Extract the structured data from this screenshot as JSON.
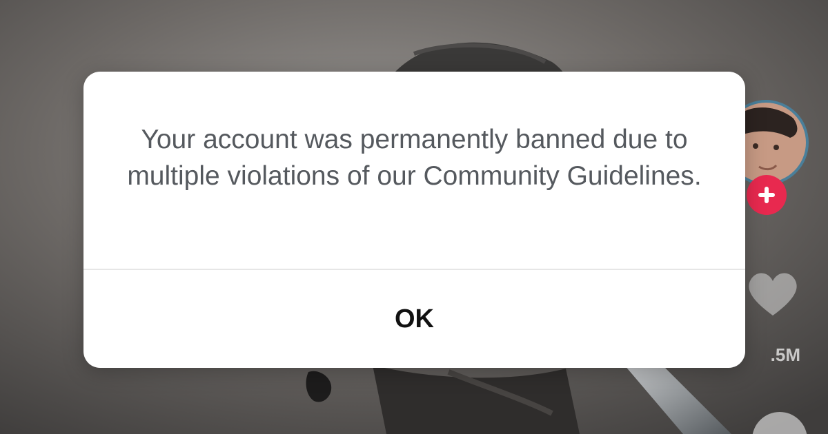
{
  "video_feed": {
    "side_rail": {
      "avatar_icon": "user-avatar-icon",
      "follow_icon": "plus-icon",
      "follow_color": "#e8294f",
      "like_icon": "heart-icon",
      "like_count": ".5M",
      "next_icon": "comment-icon"
    }
  },
  "dialog": {
    "message": "Your account was permanently banned due to multiple violations of our Community Guidelines.",
    "ok_label": "OK"
  }
}
